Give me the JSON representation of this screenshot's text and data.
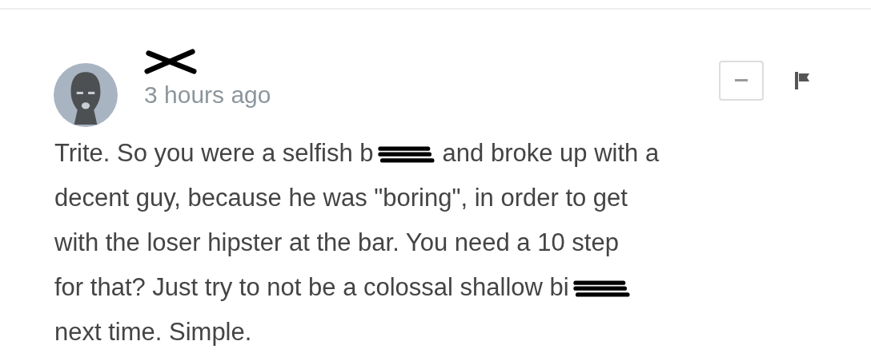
{
  "comment": {
    "time": "3 hours ago",
    "lines": [
      [
        {
          "kind": "text",
          "text": "Trite. So you were a selfish b"
        },
        {
          "kind": "redacted"
        },
        {
          "kind": "text",
          "text": "and broke up with a"
        }
      ],
      [
        {
          "kind": "text",
          "text": "decent guy, because he was \"boring\", in order to get"
        }
      ],
      [
        {
          "kind": "text",
          "text": "with the loser hipster at the bar. You need a 10 step"
        }
      ],
      [
        {
          "kind": "text",
          "text": "for that? Just try to not be a colossal shallow bi"
        },
        {
          "kind": "redacted"
        }
      ],
      [
        {
          "kind": "text",
          "text": "next time. Simple."
        }
      ]
    ]
  }
}
